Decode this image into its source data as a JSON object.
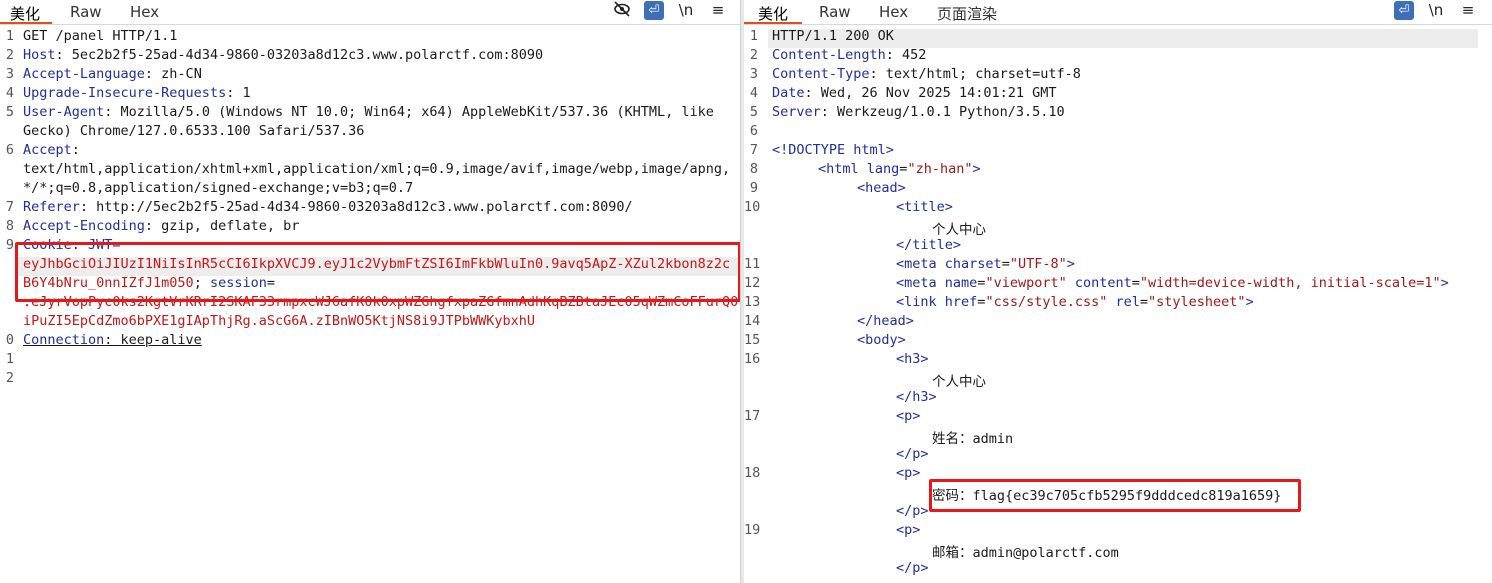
{
  "request": {
    "tabs": [
      "美化",
      "Raw",
      "Hex"
    ],
    "tools": {
      "wrap": "⏎",
      "newline": "\\n",
      "menu": "≡"
    },
    "line_numbers": [
      "1",
      "2",
      "3",
      "4",
      "5",
      "",
      "6",
      "",
      "",
      "7",
      "8",
      "9",
      "",
      "",
      "",
      "",
      "0",
      "1",
      "2"
    ],
    "lines": {
      "l1": "GET /panel HTTP/1.1",
      "l2k": "Host",
      "l2v": ": 5ec2b2f5-25ad-4d34-9860-03203a8d12c3.www.polarctf.com:8090",
      "l3k": "Accept-Language",
      "l3v": ": zh-CN",
      "l4k": "Upgrade-Insecure-Requests",
      "l4v": ": 1",
      "l5k": "User-Agent",
      "l5v": ": Mozilla/5.0 (Windows NT 10.0; Win64; x64) AppleWebKit/537.36 (KHTML, like",
      "l5b": "Gecko) Chrome/127.0.6533.100 Safari/537.36",
      "l6k": "Accept",
      "l6v": ":",
      "l6b": "text/html,application/xhtml+xml,application/xml;q=0.9,image/avif,image/webp,image/apng,",
      "l6c": "*/*;q=0.8,application/signed-exchange;v=b3;q=0.7",
      "l7k": "Referer",
      "l7v": ": http://5ec2b2f5-25ad-4d34-9860-03203a8d12c3.www.polarctf.com:8090/",
      "l8k": "Accept-Encoding",
      "l8v": ": gzip, deflate, br",
      "l9k": "Cookie",
      "l9c": ": JWT=",
      "l9b": "eyJhbGciOiJIUzI1NiIsInR5cCI6IkpXVCJ9.eyJ1c2VybmFtZSI6ImFkbWluIn0.9avq5ApZ-XZul2kbon8z2c",
      "l9d": "B6Y4bNru_0nnIZfJ1m050",
      "l9sep": "; ",
      "l9s": "session",
      "l9eq": "=",
      "l9e": ".eJyrVopPyc0ks2KgtVrKRrI2SKAF33rmpxcWJ6afK0k0xpWZGhgfxpaZGfmnAdhKqBZBtaJEc05qWZmCoFFurQ0",
      "l9f": "iPuZI5EpCdZmo6bPXE1gIApThjRg.aScG6A.zIBnWO5KtjNS8i9JTPbWWKybxhU",
      "l10k": "Connection",
      "l10v": ": keep-alive"
    }
  },
  "response": {
    "tabs": [
      "美化",
      "Raw",
      "Hex",
      "页面渲染"
    ],
    "tools": {
      "wrap": "⏎",
      "newline": "\\n",
      "menu": "≡"
    },
    "line_numbers": [
      "1",
      "2",
      "3",
      "4",
      "5",
      "6",
      "7",
      "8",
      "9",
      "10",
      "",
      "",
      "11",
      "12",
      "13",
      "14",
      "15",
      "16",
      "",
      "",
      "17",
      "",
      "",
      "18",
      "",
      "19"
    ],
    "lines": {
      "r1": "HTTP/1.1 200 OK",
      "r2k": "Content-Length",
      "r2v": ": 452",
      "r3k": "Content-Type",
      "r3v": ": text/html; charset=utf-8",
      "r4k": "Date",
      "r4v": ": Wed, 26 Nov 2025 14:01:21 GMT",
      "r5k": "Server",
      "r5v": ": Werkzeug/1.0.1 Python/3.5.10",
      "r7": "<!DOCTYPE html>",
      "r8a": "<html ",
      "r8b": "lang",
      "r8c": "=",
      "r8d": "\"zh-han\"",
      "r8e": ">",
      "r9": "<head>",
      "r10": "<title>",
      "r10t": "个人中心",
      "r10c": "</title>",
      "r11a": "<meta ",
      "r11b": "charset",
      "r11c": "=",
      "r11d": "\"UTF-8\"",
      "r11e": ">",
      "r12a": "<meta ",
      "r12b": "name",
      "r12c": "=",
      "r12d": "\"viewport\"",
      "r12f": " content",
      "r12g": "=",
      "r12h": "\"width=device-width, initial-scale=1\"",
      "r12i": ">",
      "r13a": "<link ",
      "r13b": "href",
      "r13c": "=",
      "r13d": "\"css/style.css\"",
      "r13f": " rel",
      "r13g": "=",
      "r13h": "\"stylesheet\"",
      "r13i": ">",
      "r14": "</head>",
      "r15": "<body>",
      "r16": "<h3>",
      "r16t": "个人中心",
      "r16c": "</h3>",
      "r17": "<p>",
      "r17t": "姓名：admin",
      "r17c": "</p>",
      "r18": "<p>",
      "r18t": "密码：flag{ec39c705cfb5295f9dddcedc819a1659}",
      "r18c": "</p>",
      "r19": "<p>",
      "r19t": "邮箱：admin@polarctf.com",
      "r19c": "</p>"
    }
  },
  "colors": {
    "accent": "#e0501b",
    "highlight_box": "#e81818",
    "header_key": "#1f2f9e",
    "value_red": "#c81616",
    "tool_blue": "#3d6fb6"
  }
}
